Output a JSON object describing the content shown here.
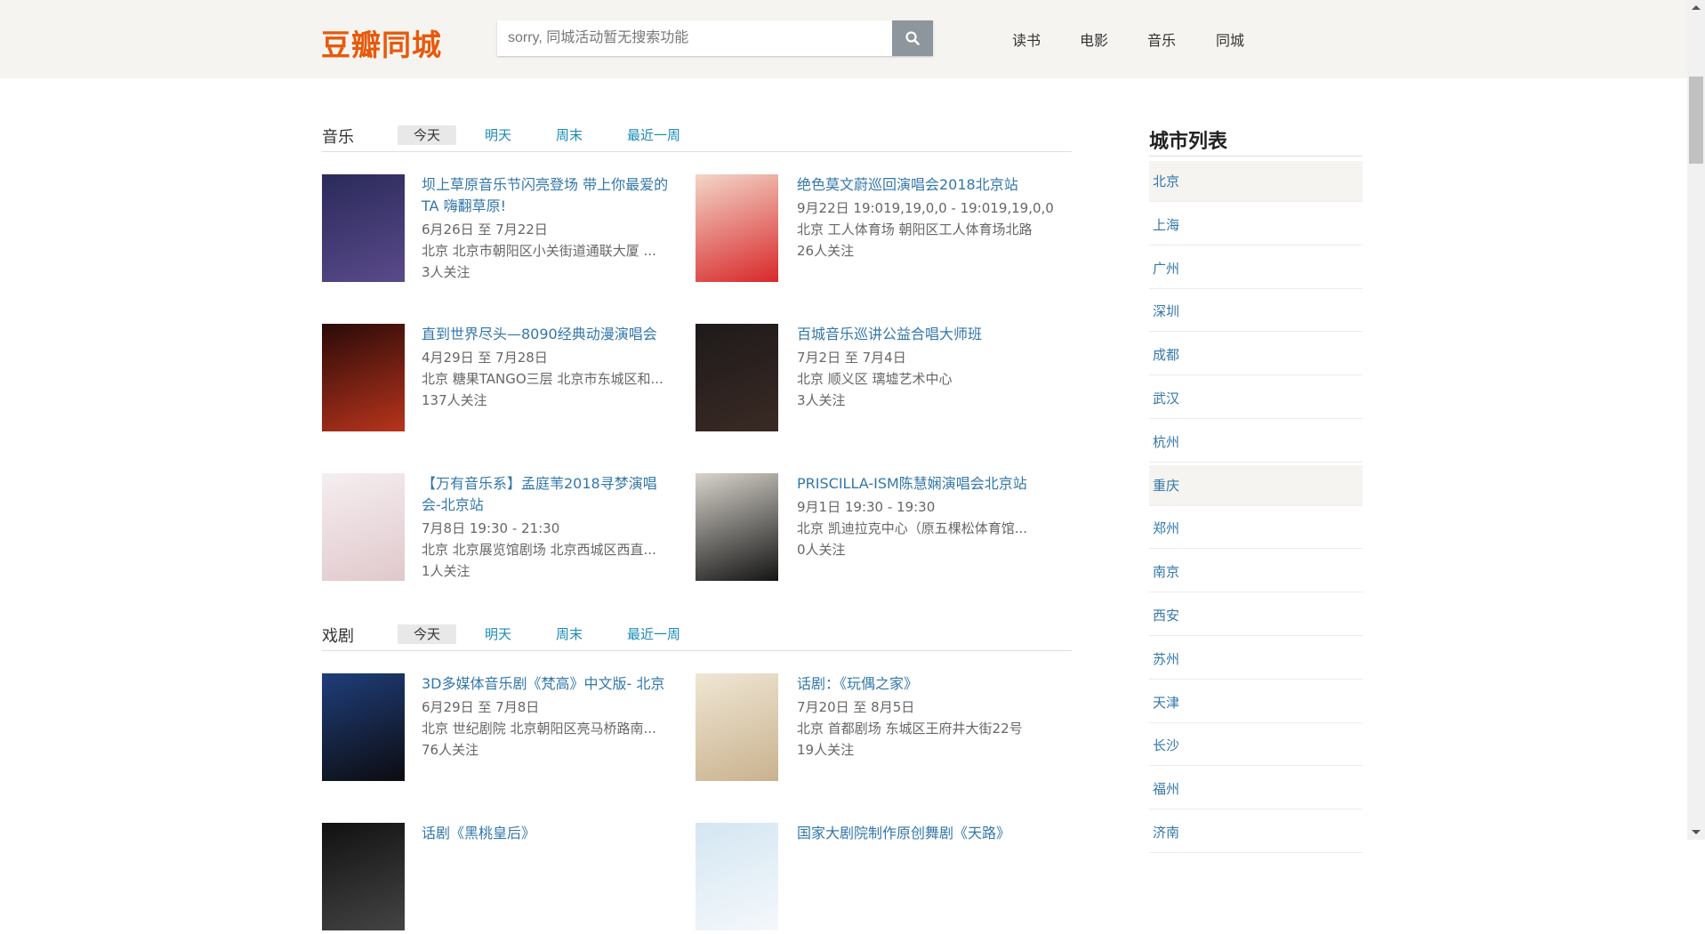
{
  "header": {
    "logo": "豆瓣同城",
    "search_placeholder": "sorry, 同城活动暂无搜索功能",
    "nav": [
      "读书",
      "电影",
      "音乐",
      "同城"
    ],
    "brand_color": "#e8590c"
  },
  "sections": [
    {
      "title": "音乐",
      "tabs": [
        "今天",
        "明天",
        "周末",
        "最近一周"
      ],
      "active_tab": "今天",
      "items": [
        {
          "title": "坝上草原音乐节闪亮登场 带上你最爱的TA 嗨翻草原!",
          "date": "6月26日 至 7月22日",
          "location": "北京 北京市朝阳区小关街道通联大厦 ...",
          "followers": "3人关注",
          "poster": [
            "#2a2a5a",
            "#5a4a8a"
          ]
        },
        {
          "title": "绝色莫文蔚巡回演唱会2018北京站",
          "date": "9月22日 19:019,19,0,0 - 19:019,19,0,0",
          "location": "北京 工人体育场 朝阳区工人体育场北路",
          "followers": "26人关注",
          "poster": [
            "#f3d6c8",
            "#d8282a"
          ]
        },
        {
          "title": "直到世界尽头—8090经典动漫演唱会",
          "date": "4月29日 至 7月28日",
          "location": "北京 糖果TANGO三层 北京市东城区和...",
          "followers": "137人关注",
          "poster": [
            "#2a0a08",
            "#b8341c"
          ]
        },
        {
          "title": "百城音乐巡讲公益合唱大师班",
          "date": "7月2日 至 7月4日",
          "location": "北京 顺义区 璃墟艺术中心",
          "followers": "3人关注",
          "poster": [
            "#1e1a1a",
            "#3a2a24"
          ]
        },
        {
          "title": "【万有音乐系】孟庭苇2018寻梦演唱会-北京站",
          "date": "7月8日 19:30 - 21:30",
          "location": "北京 北京展览馆剧场 北京西城区西直...",
          "followers": "1人关注",
          "poster": [
            "#f5eef0",
            "#e0c8cc"
          ]
        },
        {
          "title": "PRISCILLA-ISM陈慧娴演唱会北京站",
          "date": "9月1日 19:30 - 19:30",
          "location": "北京 凯迪拉克中心（原五棵松体育馆...",
          "followers": "0人关注",
          "poster": [
            "#d8d4cc",
            "#141414"
          ]
        }
      ]
    },
    {
      "title": "戏剧",
      "tabs": [
        "今天",
        "明天",
        "周末",
        "最近一周"
      ],
      "active_tab": "今天",
      "items": [
        {
          "title": "3D多媒体音乐剧《梵高》中文版- 北京",
          "date": "6月29日 至 7月8日",
          "location": "北京 世纪剧院 北京朝阳区亮马桥路南...",
          "followers": "76人关注",
          "poster": [
            "#1f3e7a",
            "#0c0c10"
          ]
        },
        {
          "title": "话剧：《玩偶之家》",
          "date": "7月20日 至 8月5日",
          "location": "北京 首都剧场 东城区王府井大街22号",
          "followers": "19人关注",
          "poster": [
            "#efe6d4",
            "#c9b28e"
          ]
        },
        {
          "title": "话剧《黑桃皇后》",
          "poster": [
            "#111111",
            "#444444"
          ]
        },
        {
          "title": "国家大剧院制作原创舞剧《天路》",
          "poster": [
            "#d4e6f2",
            "#f4f8fb"
          ]
        }
      ]
    }
  ],
  "sidebar": {
    "title": "城市列表",
    "cities": [
      "北京",
      "上海",
      "广州",
      "深圳",
      "成都",
      "武汉",
      "杭州",
      "重庆",
      "郑州",
      "南京",
      "西安",
      "苏州",
      "天津",
      "长沙",
      "福州",
      "济南"
    ],
    "highlighted": [
      "北京",
      "重庆"
    ]
  }
}
